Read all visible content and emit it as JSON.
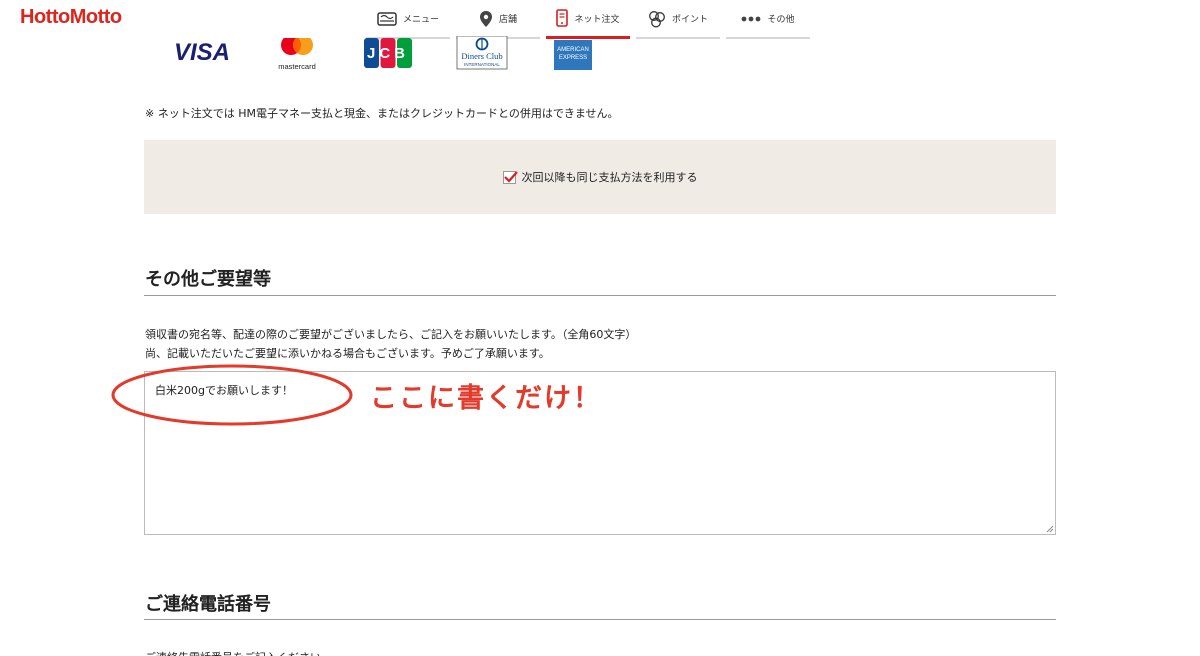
{
  "header": {
    "logo": "HottoMotto",
    "nav": [
      {
        "label": "メニュー",
        "icon": "menu-bento-icon",
        "active": false
      },
      {
        "label": "店舗",
        "icon": "location-pin-icon",
        "active": false
      },
      {
        "label": "ネット注文",
        "icon": "smartphone-icon",
        "active": true
      },
      {
        "label": "ポイント",
        "icon": "coins-icon",
        "active": false
      },
      {
        "label": "その他",
        "icon": "more-dots-icon",
        "active": false
      }
    ]
  },
  "payment": {
    "card_brands": {
      "visa": "VISA",
      "mastercard": "mastercard",
      "jcb": "JCB",
      "diners": "Diners Club",
      "diners_sub": "INTERNATIONAL",
      "amex_line1": "AMERICAN",
      "amex_line2": "EXPRESS"
    },
    "notice": "※ ネット注文では HM電子マネー支払と現金、またはクレジットカードとの併用はできません。",
    "remember_label": "次回以降も同じ支払方法を利用する",
    "remember_checked": true
  },
  "requests": {
    "title": "その他ご要望等",
    "desc_line1": "領収書の宛名等、配達の際のご要望がございましたら、ご記入をお願いいたします。（全角60文字）",
    "desc_line2": "尚、記載いただいたご要望に添いかねる場合もございます。予めご了承願います。",
    "value": "白米200gでお願いします！",
    "annotation": "ここに書くだけ！"
  },
  "phone": {
    "title": "ご連絡電話番号",
    "desc_partial": "ご連絡先電話番号をご記入ください。"
  },
  "colors": {
    "brand_red": "#e0241b",
    "nav_active": "#d71f1f",
    "band_bg": "#f0ebe5",
    "annotation_red": "#e23a2b"
  }
}
